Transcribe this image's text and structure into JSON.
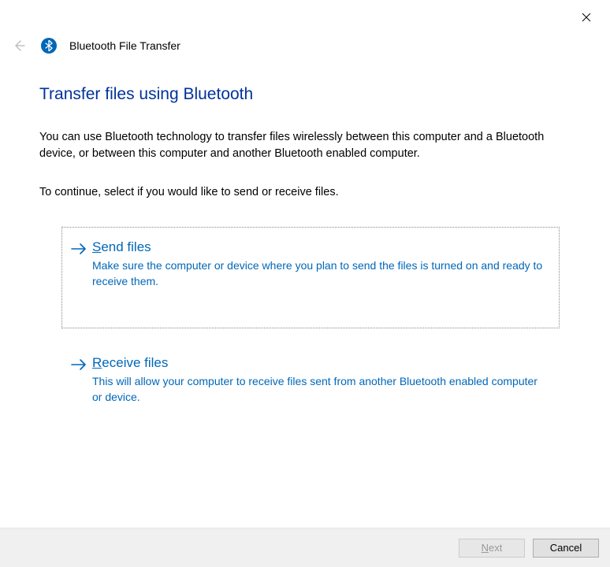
{
  "window": {
    "app_title": "Bluetooth File Transfer"
  },
  "page": {
    "heading": "Transfer files using Bluetooth",
    "description": "You can use Bluetooth technology to transfer files wirelessly between this computer and a Bluetooth device, or between this computer and another Bluetooth enabled computer.",
    "instruction": "To continue, select if you would like to send or receive files."
  },
  "options": {
    "send": {
      "title_accel": "S",
      "title_rest": "end files",
      "desc": "Make sure the computer or device where you plan to send the files is turned on and ready to receive them."
    },
    "receive": {
      "title_accel": "R",
      "title_rest": "eceive files",
      "desc": "This will allow your computer to receive files sent from another Bluetooth enabled computer or device."
    }
  },
  "footer": {
    "next_accel": "N",
    "next_rest": "ext",
    "cancel": "Cancel"
  }
}
